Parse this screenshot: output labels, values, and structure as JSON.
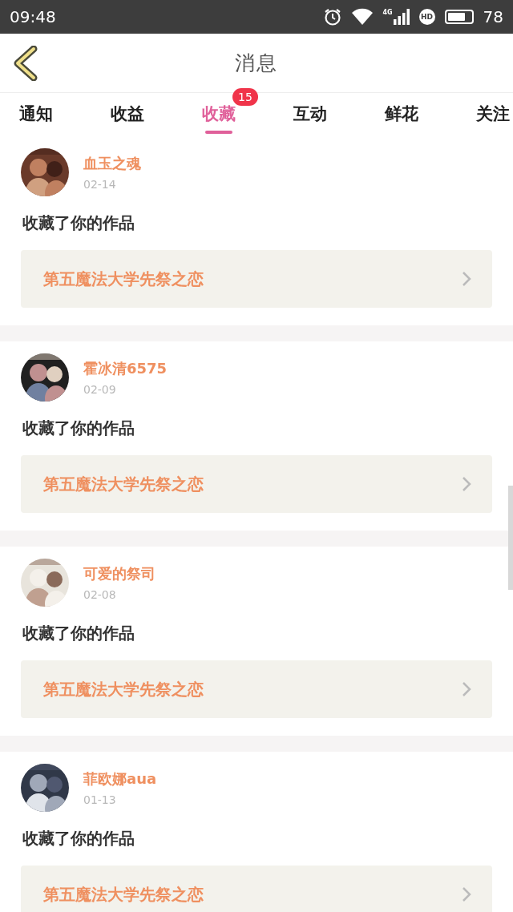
{
  "status_bar": {
    "time": "09:48",
    "network": "4G",
    "hd": "HD",
    "battery": "78"
  },
  "header": {
    "title": "消息"
  },
  "tabs": [
    {
      "label": "通知",
      "selected": false
    },
    {
      "label": "收益",
      "selected": false
    },
    {
      "label": "收藏",
      "selected": true,
      "badge": "15"
    },
    {
      "label": "互动",
      "selected": false
    },
    {
      "label": "鲜花",
      "selected": false
    },
    {
      "label": "关注",
      "selected": false
    }
  ],
  "messages": [
    {
      "user": "血玉之魂",
      "date": "02-14",
      "text": "收藏了你的作品",
      "work": "第五魔法大学先祭之恋"
    },
    {
      "user": "霍冰清6575",
      "date": "02-09",
      "text": "收藏了你的作品",
      "work": "第五魔法大学先祭之恋"
    },
    {
      "user": "可爱的祭司",
      "date": "02-08",
      "text": "收藏了你的作品",
      "work": "第五魔法大学先祭之恋"
    },
    {
      "user": "菲欧娜aua",
      "date": "01-13",
      "text": "收藏了你的作品",
      "work": "第五魔法大学先祭之恋"
    }
  ]
}
